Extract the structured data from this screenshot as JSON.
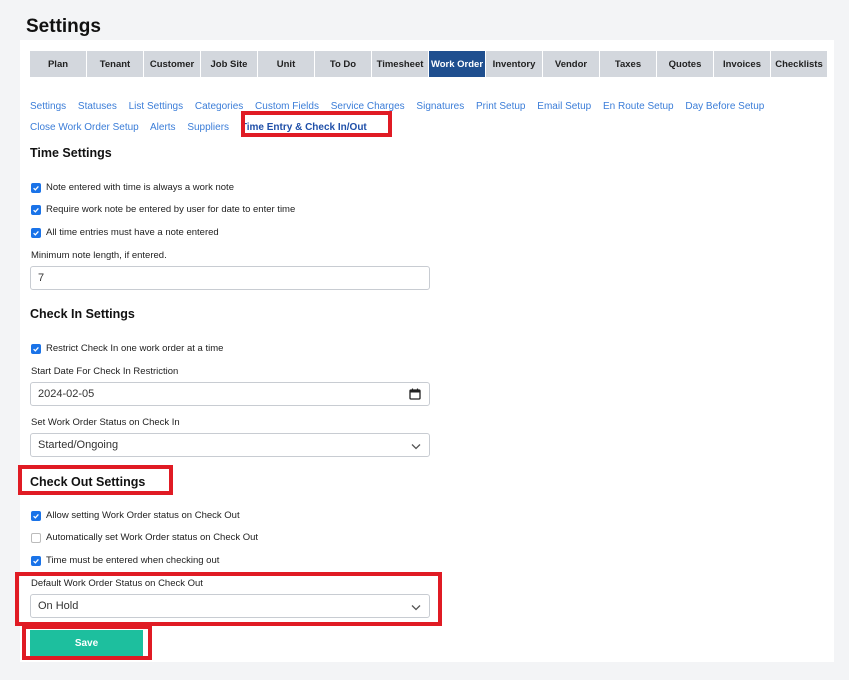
{
  "page_title": "Settings",
  "tabs": [
    {
      "label": "Plan",
      "width": 56
    },
    {
      "label": "Tenant",
      "width": 56
    },
    {
      "label": "Customer",
      "width": 56
    },
    {
      "label": "Job Site",
      "width": 56
    },
    {
      "label": "Unit",
      "width": 56
    },
    {
      "label": "To Do",
      "width": 56
    },
    {
      "label": "Timesheet",
      "width": 56
    },
    {
      "label": "Work Order",
      "width": 56
    },
    {
      "label": "Inventory",
      "width": 56
    },
    {
      "label": "Vendor",
      "width": 56
    },
    {
      "label": "Taxes",
      "width": 56
    },
    {
      "label": "Quotes",
      "width": 56
    },
    {
      "label": "Invoices",
      "width": 56
    },
    {
      "label": "Checklists",
      "width": 56
    }
  ],
  "subnav": [
    "Settings",
    "Statuses",
    "List Settings",
    "Categories",
    "Custom Fields",
    "Service Charges",
    "Signatures",
    "Print Setup",
    "Email Setup",
    "En Route Setup",
    "Day Before Setup",
    "Close Work Order Setup",
    "Alerts",
    "Suppliers",
    "Time Entry & Check In/Out"
  ],
  "time_settings": {
    "title": "Time Settings",
    "checks": [
      {
        "label": "Note entered with time is always a work note",
        "checked": true
      },
      {
        "label": "Require work note be entered by user for date to enter time",
        "checked": true
      },
      {
        "label": "All time entries must have a note entered",
        "checked": true
      }
    ],
    "min_note_label": "Minimum note length, if entered.",
    "min_note_value": "7"
  },
  "check_in": {
    "title": "Check In Settings",
    "restrict_label": "Restrict Check In one work order at a time",
    "restrict_checked": true,
    "start_date_label": "Start Date For Check In Restriction",
    "start_date_value": "2024-02-05",
    "status_label": "Set Work Order Status on Check In",
    "status_value": "Started/Ongoing"
  },
  "check_out": {
    "title": "Check Out Settings",
    "checks": [
      {
        "label": "Allow setting Work Order status on Check Out",
        "checked": true
      },
      {
        "label": "Automatically set Work Order status on Check Out",
        "checked": false
      },
      {
        "label": "Time must be entered when checking out",
        "checked": true
      }
    ],
    "default_status_label": "Default Work Order Status on Check Out",
    "default_status_value": "On Hold"
  },
  "save_label": "Save",
  "colors": {
    "accent": "#1f4f8f",
    "save": "#1dbf9e",
    "highlight": "#e01b24",
    "link": "#3b7dd8"
  }
}
